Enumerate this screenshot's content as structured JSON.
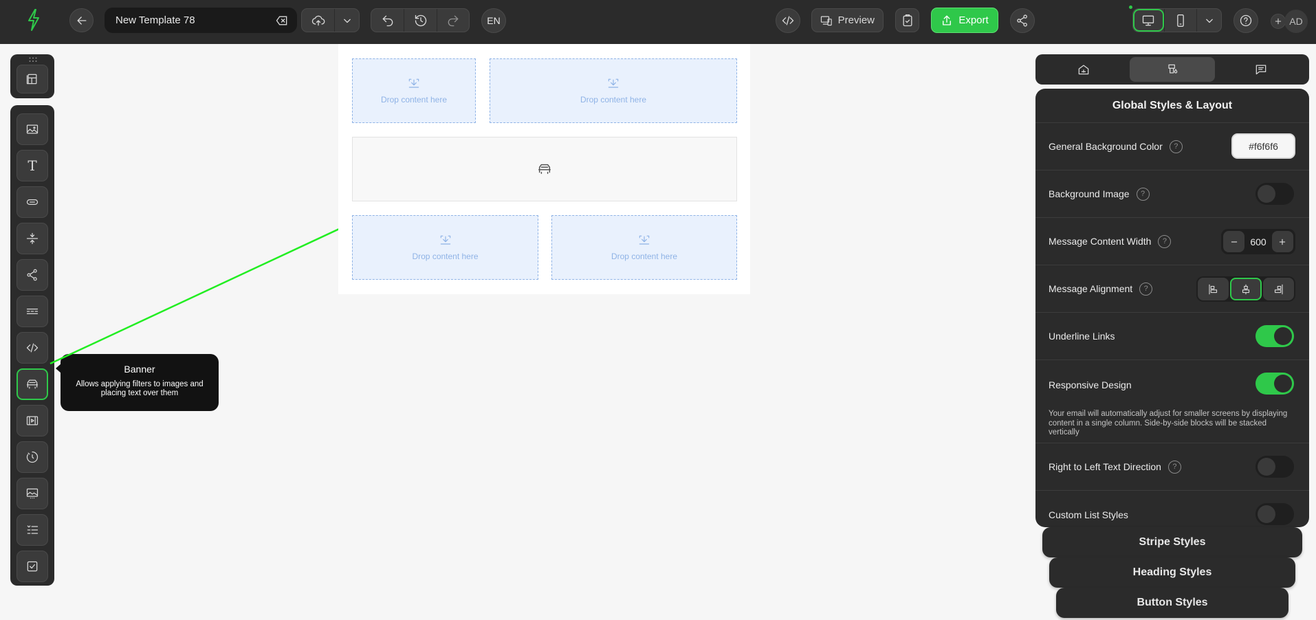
{
  "header": {
    "template_name": "New Template 78",
    "language": "EN",
    "preview_label": "Preview",
    "export_label": "Export",
    "avatar_initials": "AD"
  },
  "tooltip": {
    "title": "Banner",
    "description": "Allows applying filters to images and placing text over them"
  },
  "canvas": {
    "drop_label": "Drop content here"
  },
  "right_panel": {
    "title": "Global Styles & Layout",
    "rows": {
      "bg_color_label": "General Background Color",
      "bg_color_value": "#f6f6f6",
      "bg_image_label": "Background Image",
      "bg_image_on": false,
      "content_width_label": "Message Content Width",
      "content_width_value": "600",
      "alignment_label": "Message Alignment",
      "alignment_selected": "center",
      "underline_label": "Underline Links",
      "underline_on": true,
      "responsive_label": "Responsive Design",
      "responsive_on": true,
      "responsive_desc": "Your email will automatically adjust for smaller screens by displaying content in a single column. Side-by-side blocks will be stacked vertically",
      "rtl_label": "Right to Left Text Direction",
      "rtl_on": false,
      "custom_list_label": "Custom List Styles",
      "custom_list_on": false
    },
    "accordions": {
      "stripe": "Stripe Styles",
      "heading": "Heading Styles",
      "button": "Button Styles"
    }
  },
  "colors": {
    "accent": "#2fc84a",
    "topbar": "#2b2b2b",
    "canvas_bg": "#f6f6f6",
    "drop_zone": "#e9f1fd"
  }
}
